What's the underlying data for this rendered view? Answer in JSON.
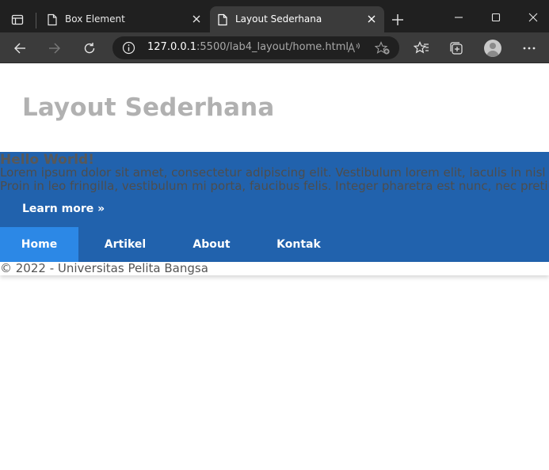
{
  "browser": {
    "tabs": [
      {
        "title": "Box Element",
        "active": false
      },
      {
        "title": "Layout Sederhana",
        "active": true
      }
    ],
    "url": {
      "host": "127.0.0.1",
      "rest": ":5500/lab4_layout/home.html"
    },
    "icons": {
      "tab_actions": "tab-actions-icon",
      "page": "page-icon",
      "close": "close-icon",
      "new_tab": "plus-icon",
      "minimize": "minimize-icon",
      "maximize": "maximize-icon",
      "window_close": "close-icon",
      "back": "arrow-left-icon",
      "forward": "arrow-right-icon",
      "reload": "reload-icon",
      "site_info": "info-icon",
      "read_aloud": "read-aloud-icon",
      "add_favorite": "star-plus-icon",
      "favorites": "favorites-icon",
      "collections": "collections-icon",
      "profile": "avatar-icon",
      "more": "more-icon"
    }
  },
  "page": {
    "header": {
      "title": "Layout Sederhana"
    },
    "hero": {
      "title": "Hello World!",
      "line1": "Lorem ipsum dolor sit amet, consectetur adipiscing elit. Vestibulum lorem elit, iaculis in nisl vo",
      "line2": "Proin in leo fringilla, vestibulum mi porta, faucibus felis. Integer pharetra est nunc, nec pretiu",
      "learn_more": "Learn more »"
    },
    "nav": [
      {
        "label": "Home",
        "active": true
      },
      {
        "label": "Artikel",
        "active": false
      },
      {
        "label": "About",
        "active": false
      },
      {
        "label": "Kontak",
        "active": false
      }
    ],
    "footer": {
      "text": "© 2022 - Universitas Pelita Bangsa"
    }
  },
  "colors": {
    "chrome_dark": "#202020",
    "chrome_mid": "#3b3b3b",
    "header_title": "#b1b1b1",
    "hero_bg": "#2162ad",
    "nav_active": "#2c88e6",
    "nav_text": "#ffffff"
  }
}
